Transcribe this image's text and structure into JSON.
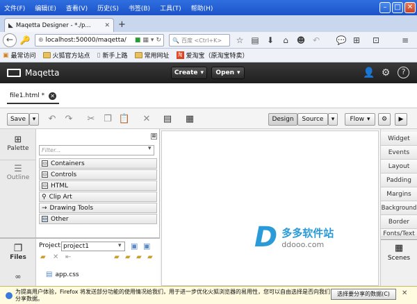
{
  "browser": {
    "menu": [
      "文件(F)",
      "编辑(E)",
      "查看(V)",
      "历史(S)",
      "书签(B)",
      "工具(T)",
      "帮助(H)"
    ],
    "tab_title": "Maqetta Designer - *./p...",
    "url": "localhost:50000/maqetta/",
    "search_placeholder": "百度 <Ctrl+K>",
    "bookmarks": [
      "最常访问",
      "火狐官方站点",
      "新手上路",
      "常用网址",
      "爱淘宝（原淘宝特卖）"
    ]
  },
  "maqetta": {
    "logo": "Maqetta",
    "create_label": "Create",
    "open_label": "Open",
    "file_tab": "file1.html *",
    "save_label": "Save",
    "design_label": "Design",
    "source_label": "Source",
    "flow_label": "Flow",
    "palette_label": "Palette",
    "outline_label": "Outline",
    "filter_placeholder": "Filter...",
    "palette_items": [
      "Containers",
      "Controls",
      "HTML",
      "Clip Art",
      "Drawing Tools",
      "Other"
    ],
    "files_label": "Files",
    "project_label": "Project:",
    "project_value": "project1",
    "file_item": "app.css",
    "right_tabs": [
      "Widget",
      "Events",
      "Layout",
      "Padding",
      "Margins",
      "Background",
      "Border",
      "Fonts/Text"
    ],
    "scenes_label": "Scenes"
  },
  "watermark": {
    "title": "多多软件站",
    "url": "ddooo.com"
  },
  "notification": {
    "text": "为提高用户体验，Firefox 将发送部分功能的使用情况给我们，用于进一步优化火狐浏览器的易用性，您可以自由选择是否向我们分享数据。",
    "button": "选择要分享的数据(C)"
  },
  "colors": {
    "titlebar": "#1c52c9",
    "maqetta_header": "#1e1e1e",
    "watermark": "#2a9bd8"
  }
}
